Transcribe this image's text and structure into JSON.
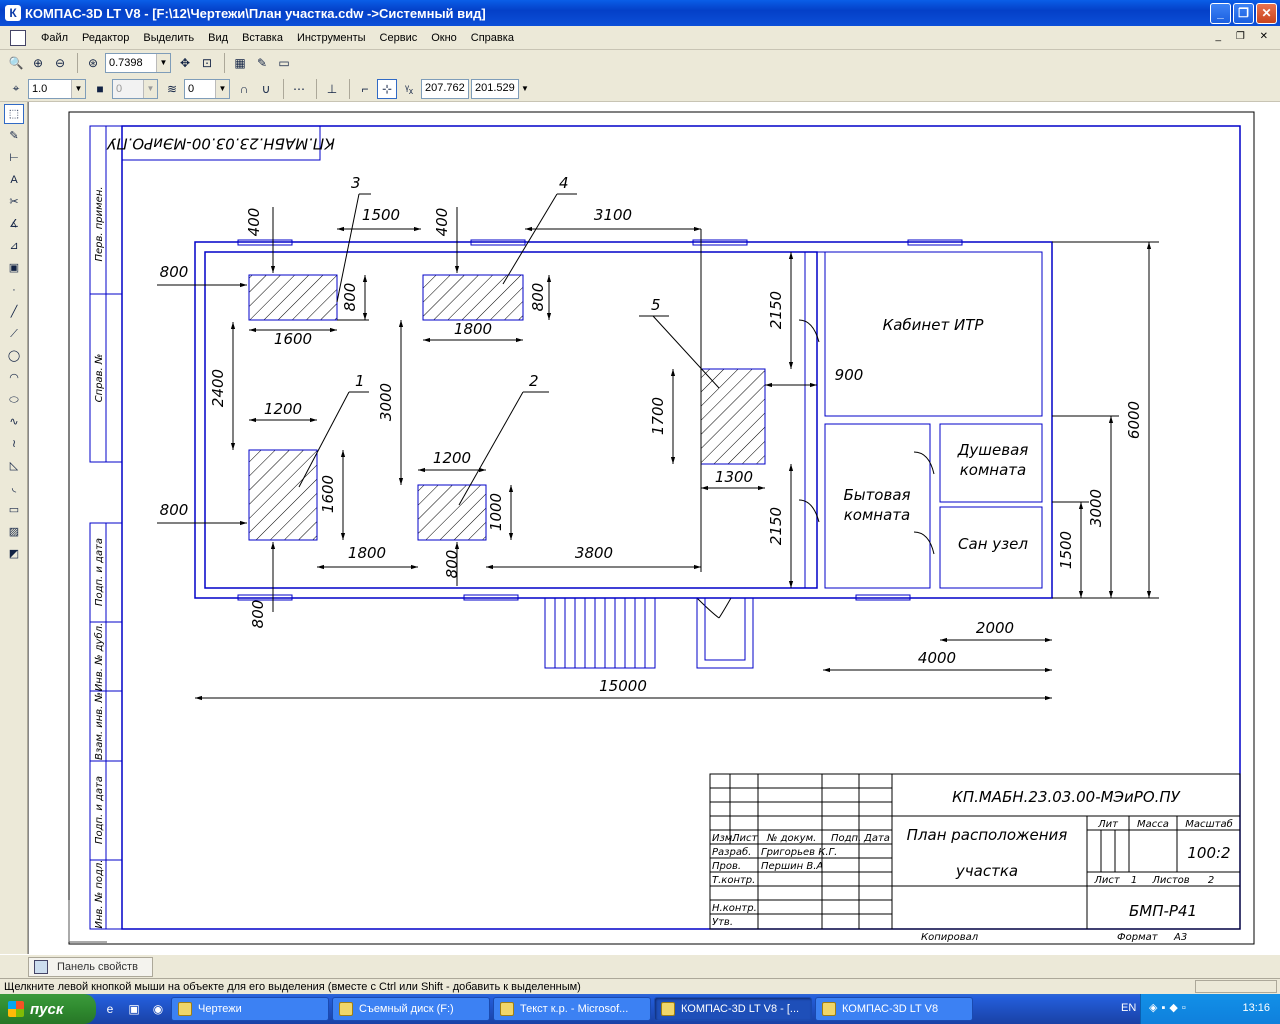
{
  "window": {
    "title": "КОМПАС-3D LT V8 - [F:\\12\\Чертежи\\План участка.cdw ->Системный вид]",
    "app_icon": "kompas-logo-icon",
    "minimize_label": "_",
    "restore_label": "❐",
    "close_label": "✕"
  },
  "menu": {
    "items": [
      "Файл",
      "Редактор",
      "Выделить",
      "Вид",
      "Вставка",
      "Инструменты",
      "Сервис",
      "Окно",
      "Справка"
    ],
    "mdi_controls": "_ ❐ ✕"
  },
  "toolbar1": {
    "zoom_value": "0.7398"
  },
  "toolbar2": {
    "step_value": "1.0",
    "style_value": "0",
    "layer_value": "0",
    "coord_x": "207.762",
    "coord_y": "201.529"
  },
  "drawing": {
    "stamp_top": "КП.МАБН.23.03.00-МЭиРО.ПУ",
    "side_labels": [
      "Перв. примен.",
      "Справ. №",
      "Подп. и дата",
      "Инв. № дубл.",
      "Взам. инв. №",
      "Подп. и дата",
      "Инв. № подл."
    ],
    "dimensions": {
      "d400a": "400",
      "d1500": "1500",
      "d400b": "400",
      "d3100": "3100",
      "d800_left_top": "800",
      "d800_box3": "800",
      "d1600_box3": "1600",
      "d800_box4": "800",
      "d1800_box4": "1800",
      "d2150_top": "2150",
      "d2400": "2400",
      "d3000": "3000",
      "d1200_box1": "1200",
      "d1700": "1700",
      "d900": "900",
      "d1200_box2": "1200",
      "d1300": "1300",
      "d1600_box1": "1600",
      "d1000_box2": "1000",
      "d800_left_bottom": "800",
      "d1800_bottom": "1800",
      "d3800": "3800",
      "d800_box2": "800",
      "d2150_bottom": "2150",
      "d800_bottom": "800",
      "d2000": "2000",
      "d4000": "4000",
      "d15000": "15000",
      "d6000": "6000",
      "d3000_right": "3000",
      "d1500_right": "1500"
    },
    "callouts": [
      "1",
      "2",
      "3",
      "4",
      "5"
    ],
    "rooms": {
      "itr": "Кабинет ИТР",
      "shower_1": "Душевая",
      "shower_2": "комната",
      "living_1": "Бытовая",
      "living_2": "комната",
      "wc": "Сан узел"
    },
    "title_block": {
      "doc_code": "КП.МАБН.23.03.00-МЭиРО.ПУ",
      "name_line1": "План расположения",
      "name_line2": "участка",
      "lit": "Лит",
      "mass": "Масса",
      "scale": "Масштаб",
      "scale_value": "100:2",
      "sheet": "Лист",
      "sheet_no": "1",
      "sheets": "Листов",
      "sheets_no": "2",
      "org": "БМП-Р41",
      "col_izm": "Изм.",
      "col_list": "Лист",
      "col_doc": "№ докум.",
      "col_sign": "Подп.",
      "col_date": "Дата",
      "row_razrab": "Разраб.",
      "razrab_name": "Григорьев К.Г.",
      "row_prov": "Пров.",
      "prov_name": "Першин В.А",
      "row_tkontr": "Т.контр.",
      "row_nkontr": "Н.контр.",
      "row_utv": "Утв.",
      "copied": "Копировал",
      "format": "Формат",
      "format_value": "А3"
    }
  },
  "property_panel": {
    "tab_label": "Панель свойств"
  },
  "status": {
    "hint": "Щелкните левой кнопкой мыши на объекте для его выделения (вместе с Ctrl или Shift - добавить к выделенным)"
  },
  "taskbar": {
    "start_label": "пуск",
    "tasks": [
      "Чертежи",
      "Съемный диск (F:)",
      "Текст к.р. - Microsof...",
      "КОМПАС-3D LT V8 - [...",
      "КОМПАС-3D LT V8"
    ],
    "lang": "EN",
    "clock": "13:16"
  }
}
